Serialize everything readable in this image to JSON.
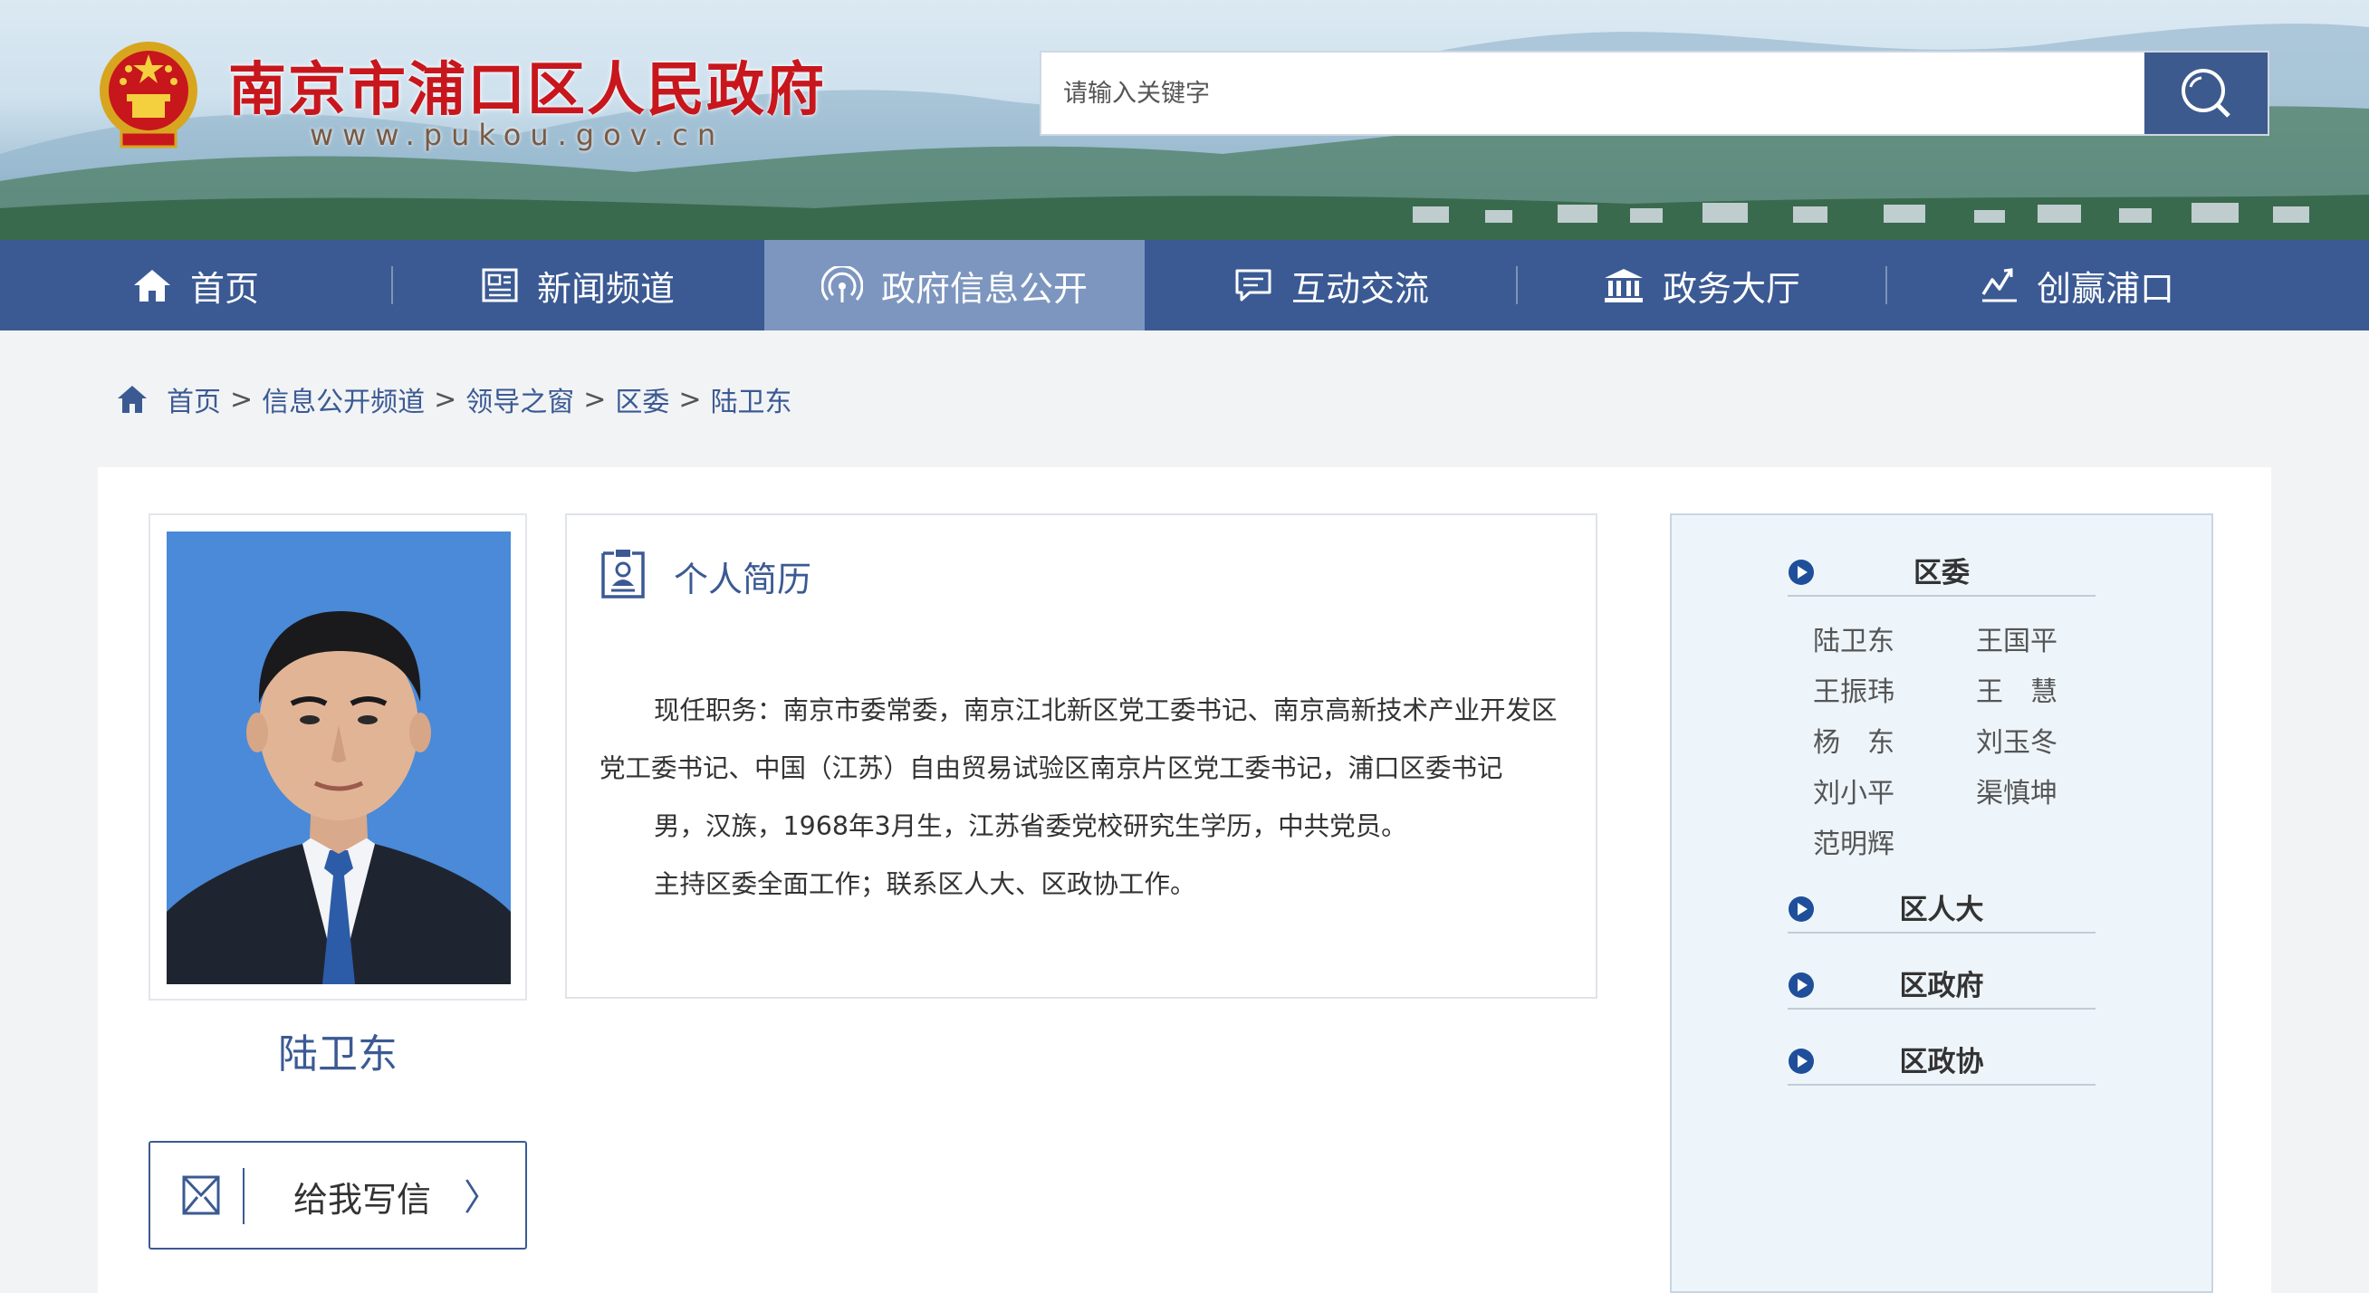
{
  "header": {
    "site_title": "南京市浦口区人民政府",
    "site_domain": "www.pukou.gov.cn",
    "search_placeholder": "请输入关键字"
  },
  "nav": {
    "items": [
      {
        "label": "首页",
        "icon": "home-icon"
      },
      {
        "label": "新闻频道",
        "icon": "newspaper-icon"
      },
      {
        "label": "政府信息公开",
        "icon": "broadcast-icon",
        "active": true
      },
      {
        "label": "互动交流",
        "icon": "chat-icon"
      },
      {
        "label": "政务大厅",
        "icon": "building-icon"
      },
      {
        "label": "创赢浦口",
        "icon": "chart-icon"
      }
    ]
  },
  "breadcrumb": {
    "items": [
      "首页",
      "信息公开频道",
      "领导之窗",
      "区委",
      "陆卫东"
    ],
    "separator": ">"
  },
  "profile": {
    "name": "陆卫东",
    "write_letter_label": "给我写信",
    "chevron": "〉"
  },
  "bio": {
    "title": "个人简历",
    "paragraphs": [
      "现任职务：南京市委常委，南京江北新区党工委书记、南京高新技术产业开发区党工委书记、中国（江苏）自由贸易试验区南京片区党工委书记，浦口区委书记",
      "男，汉族，1968年3月生，江苏省委党校研究生学历，中共党员。",
      "主持区委全面工作；联系区人大、区政协工作。"
    ]
  },
  "sidebar": {
    "categories": [
      {
        "label": "区委",
        "members": [
          "陆卫东",
          "王国平",
          "王振玮",
          "王　慧",
          "杨　东",
          "刘玉冬",
          "刘小平",
          "渠慎坤",
          "范明辉"
        ]
      },
      {
        "label": "区人大"
      },
      {
        "label": "区政府"
      },
      {
        "label": "区政协"
      }
    ]
  },
  "colors": {
    "nav_bg": "#3b5a93",
    "nav_active": "#7d96bf",
    "title_red": "#c8161d",
    "link_blue": "#3b5a93",
    "sidebar_bg": "#eef5fa"
  }
}
